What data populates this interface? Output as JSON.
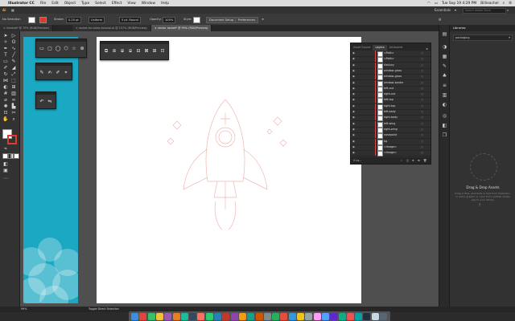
{
  "menubar": {
    "app_name": "Illustrator CC",
    "items": [
      "File",
      "Edit",
      "Object",
      "Type",
      "Select",
      "Effect",
      "View",
      "Window",
      "Help"
    ],
    "clock": "Tue Sep 19  4:29 PM",
    "user": "Billieachel"
  },
  "appbar": {
    "logo": "Ai",
    "workspace": "Essentials",
    "search_placeholder": "Search Adobe Stock"
  },
  "controlbar": {
    "selection_label": "No Selection",
    "stroke_label": "Stroke:",
    "stroke_value": "0.25 pt",
    "profile_value": "Uniform",
    "brush_value": "5 pt. Round",
    "opacity_label": "Opacity:",
    "opacity_value": "100%",
    "style_label": "Style:",
    "doc_setup_button": "Document Setup",
    "preferences_button": "Preferences",
    "fill_color": "#ffffff",
    "stroke_color": "#e03a2f"
  },
  "tabs": [
    {
      "label": "Illustrat* @ 75% (RGB/Preview)"
    },
    {
      "label": "rocket-for-video-tutorial.ai @ 157% (RGB/Preview)"
    },
    {
      "label": "vector rocket* @ 99% (RGB/Preview)"
    }
  ],
  "layers_panel": {
    "tabs": [
      "Asset Export",
      "Layers",
      "Artboards"
    ],
    "rows": [
      {
        "name": "<Path>"
      },
      {
        "name": "<Path>"
      },
      {
        "name": "rfactory"
      },
      {
        "name": "window-glass"
      },
      {
        "name": "window-glass"
      },
      {
        "name": "window-border"
      },
      {
        "name": "left-out"
      },
      {
        "name": "right-out"
      },
      {
        "name": "left-top"
      },
      {
        "name": "right-top"
      },
      {
        "name": "left-body"
      },
      {
        "name": "right-body"
      },
      {
        "name": "left-wing"
      },
      {
        "name": "right-wing"
      },
      {
        "name": "nosepoint"
      },
      {
        "name": "bg"
      },
      {
        "name": "<Image>"
      },
      {
        "name": "<Image>"
      }
    ],
    "footer_count": "2 La..."
  },
  "library_panel": {
    "title": "Libraries",
    "dropdown": "packaging",
    "empty_title": "Drag & Drop Assets",
    "empty_text": "Drag in files, elements or text from Illustrator, or add a graphic or color from another Adobe app to your library.",
    "help_icon": "?"
  },
  "statusbar": {
    "zoom": "99%",
    "tool_label": "Toggle Direct Selection"
  },
  "palette_top_title": "",
  "colors": {
    "accent_teal": "#1aa8c2",
    "layer_color": "#d84a4a"
  }
}
